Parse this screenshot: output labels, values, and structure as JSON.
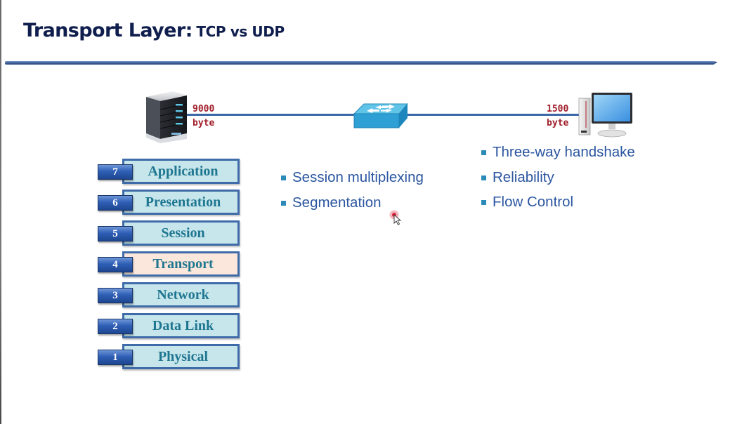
{
  "slide": {
    "title_main": "Transport Layer:",
    "title_sub": "TCP vs UDP"
  },
  "diagram": {
    "left_device": {
      "icon": "server-icon",
      "mtu_value": "9000",
      "mtu_unit": "byte"
    },
    "middle_device": {
      "icon": "switch-icon"
    },
    "right_device": {
      "icon": "desktop-pc-icon",
      "mtu_value": "1500",
      "mtu_unit": "byte"
    },
    "link_color": "#3b66a8",
    "mtu_color": "#a01e2a"
  },
  "osi_model": {
    "highlighted_layer": 4,
    "highlight_color": "#fbe7dc",
    "default_color": "#c6e6ec",
    "layers": [
      {
        "number": "7",
        "name": "Application"
      },
      {
        "number": "6",
        "name": "Presentation"
      },
      {
        "number": "5",
        "name": "Session"
      },
      {
        "number": "4",
        "name": "Transport"
      },
      {
        "number": "3",
        "name": "Network"
      },
      {
        "number": "2",
        "name": "Data Link"
      },
      {
        "number": "1",
        "name": "Physical"
      }
    ]
  },
  "bullets_middle": [
    "Session multiplexing",
    "Segmentation"
  ],
  "bullets_right": [
    "Three-way handshake",
    "Reliability",
    "Flow Control"
  ],
  "colors": {
    "title": "#0f1e4d",
    "bullet_text": "#2b56a0",
    "bullet_marker": "#2c8ab8",
    "layer_text": "#1f7690",
    "layer_border": "#3f6ca8"
  }
}
